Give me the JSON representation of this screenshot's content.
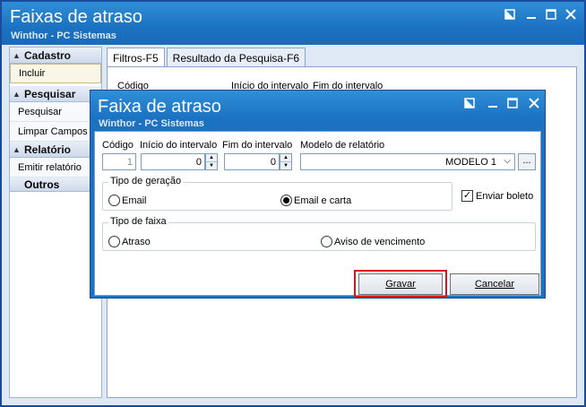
{
  "main": {
    "title": "Faixas de atraso",
    "subtitle": "Winthor - PC Sistemas"
  },
  "sidebar": {
    "groups": [
      {
        "label": "Cadastro",
        "items": [
          "Incluir"
        ]
      },
      {
        "label": "Pesquisar",
        "items": [
          "Pesquisar",
          "Limpar Campos"
        ]
      },
      {
        "label": "Relatório",
        "items": [
          "Emitir relatório"
        ]
      }
    ],
    "outros": "Outros"
  },
  "tabs": [
    {
      "label": "Filtros-F5"
    },
    {
      "label": "Resultado da Pesquisa-F6"
    }
  ],
  "background_labels": {
    "codigo": "Código",
    "inicio": "Início do intervalo",
    "fim": "Fim do intervalo"
  },
  "dialog": {
    "title": "Faixa de atraso",
    "subtitle": "Winthor - PC Sistemas",
    "codigo_label": "Código",
    "codigo_value": "1",
    "inicio_label": "Início do intervalo",
    "inicio_value": "0",
    "fim_label": "Fim do intervalo",
    "fim_value": "0",
    "modelo_label": "Modelo de relatório",
    "modelo_value": "MODELO 1",
    "ellipsis": "...",
    "tipo_geracao_label": "Tipo de geração",
    "opt_email": "Email",
    "opt_email_carta": "Email e carta",
    "enviar_boleto": "Enviar boleto",
    "tipo_faixa_label": "Tipo de faixa",
    "opt_atraso": "Atraso",
    "opt_aviso": "Aviso de vencimento",
    "gravar": "Gravar",
    "cancelar": "Cancelar"
  }
}
